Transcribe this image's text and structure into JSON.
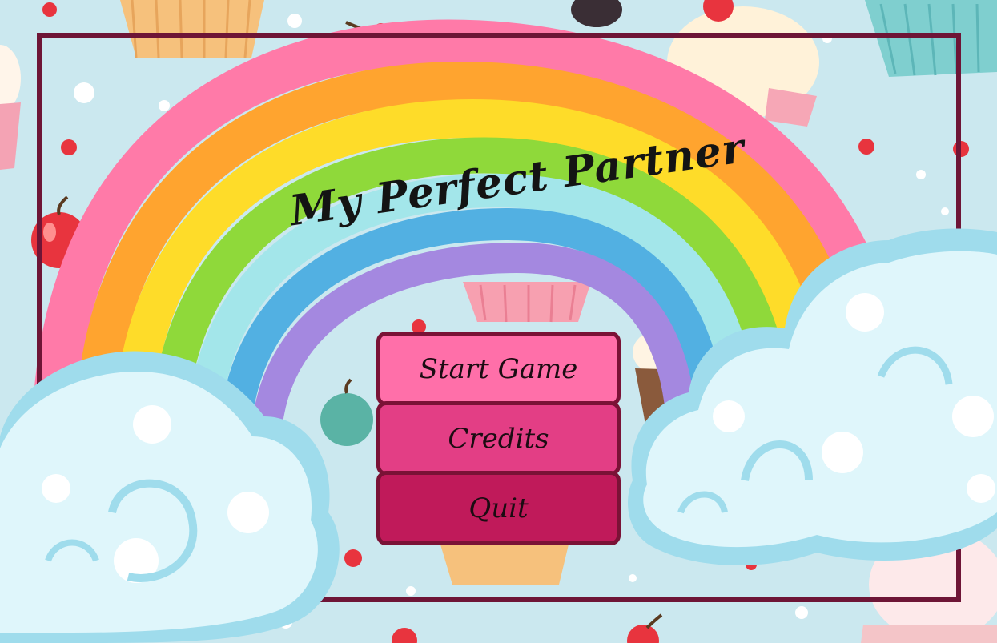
{
  "game": {
    "title": "My Perfect Partner"
  },
  "menu": {
    "start_label": "Start Game",
    "credits_label": "Credits",
    "quit_label": "Quit"
  },
  "colors": {
    "frame": "#6e1536",
    "rainbow": [
      "#ff7aa8",
      "#ffa42f",
      "#fedc29",
      "#8fd93a",
      "#a3e6ea",
      "#52b0e2",
      "#a488e0"
    ],
    "start_button": "#ff6fa9",
    "credits_button": "#e33e85",
    "quit_button": "#c01a5a"
  }
}
